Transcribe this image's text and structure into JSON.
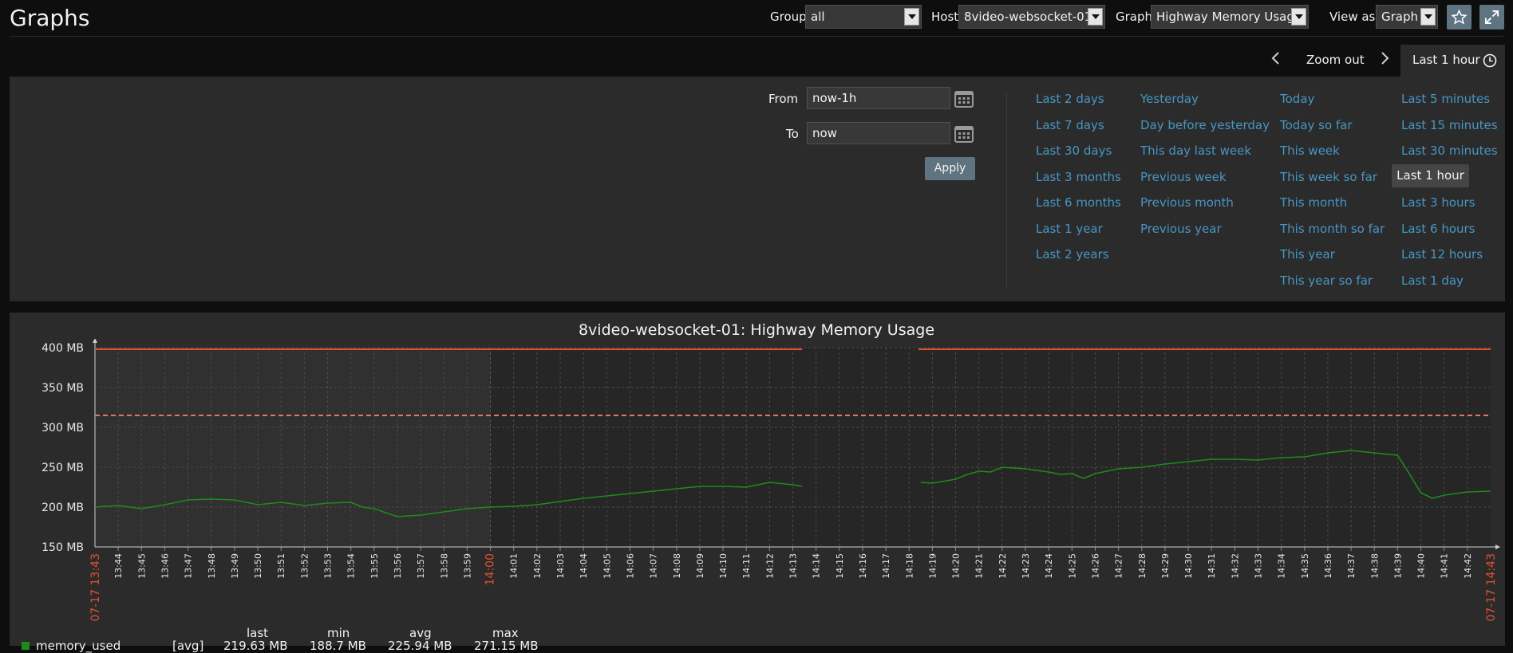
{
  "page": {
    "title": "Graphs"
  },
  "filters": {
    "group_label": "Group",
    "group_value": "all",
    "host_label": "Host",
    "host_value": "8video-websocket-01",
    "graph_label": "Graph",
    "graph_value": "Highway Memory Usage",
    "viewas_label": "View as",
    "viewas_value": "Graph"
  },
  "timenav": {
    "zoom_out": "Zoom out",
    "active_tab": "Last 1 hour"
  },
  "timeform": {
    "from_label": "From",
    "from_value": "now-1h",
    "to_label": "To",
    "to_value": "now",
    "apply": "Apply"
  },
  "quick_ranges": [
    [
      "Last 2 days",
      "Last 7 days",
      "Last 30 days",
      "Last 3 months",
      "Last 6 months",
      "Last 1 year",
      "Last 2 years"
    ],
    [
      "Yesterday",
      "Day before yesterday",
      "This day last week",
      "Previous week",
      "Previous month",
      "Previous year"
    ],
    [
      "Today",
      "Today so far",
      "This week",
      "This week so far",
      "This month",
      "This month so far",
      "This year",
      "This year so far"
    ],
    [
      "Last 5 minutes",
      "Last 15 minutes",
      "Last 30 minutes",
      "Last 1 hour",
      "Last 3 hours",
      "Last 6 hours",
      "Last 12 hours",
      "Last 1 day"
    ]
  ],
  "quick_selected": "Last 1 hour",
  "graph": {
    "title": "8video-websocket-01: Highway Memory Usage"
  },
  "colors": {
    "accent": "#4796c4",
    "button": "#5e7480",
    "series": "#1e8a1e",
    "trigger": "#e0522f",
    "threshold": "#e07a5f",
    "edge_label": "#e0522f"
  },
  "icons": [
    "star-icon",
    "fullscreen-icon",
    "chevron-left-icon",
    "chevron-right-icon",
    "clock-icon",
    "calendar-icon"
  ],
  "chart_data": {
    "type": "line",
    "title": "8video-websocket-01: Highway Memory Usage",
    "x_start_label": "07-17 13:43",
    "x_end_label": "07-17 14:43",
    "x_ticks": [
      "13:44",
      "13:45",
      "13:46",
      "13:47",
      "13:48",
      "13:49",
      "13:50",
      "13:51",
      "13:52",
      "13:53",
      "13:54",
      "13:55",
      "13:56",
      "13:57",
      "13:58",
      "13:59",
      "14:00",
      "14:01",
      "14:02",
      "14:03",
      "14:04",
      "14:05",
      "14:06",
      "14:07",
      "14:08",
      "14:09",
      "14:10",
      "14:11",
      "14:12",
      "14:13",
      "14:14",
      "14:15",
      "14:16",
      "14:17",
      "14:18",
      "14:19",
      "14:20",
      "14:21",
      "14:22",
      "14:23",
      "14:24",
      "14:25",
      "14:26",
      "14:27",
      "14:28",
      "14:29",
      "14:30",
      "14:31",
      "14:32",
      "14:33",
      "14:34",
      "14:35",
      "14:36",
      "14:37",
      "14:38",
      "14:39",
      "14:40",
      "14:41",
      "14:42"
    ],
    "highlight_tick": "14:00",
    "y_ticks": [
      "400 MB",
      "350 MB",
      "300 MB",
      "250 MB",
      "200 MB",
      "150 MB"
    ],
    "ylim": [
      150,
      400
    ],
    "xlim_minutes": [
      0,
      60
    ],
    "grid": true,
    "trigger_line_mb": 398,
    "threshold_line_mb": 315,
    "gap_minutes": [
      30.4,
      35.5
    ],
    "series": [
      {
        "values": [
          [
            0,
            200
          ],
          [
            1,
            202
          ],
          [
            2,
            198
          ],
          [
            3,
            203
          ],
          [
            4,
            209
          ],
          [
            5,
            210
          ],
          [
            6,
            209
          ],
          [
            7,
            203
          ],
          [
            8,
            206
          ],
          [
            9,
            202
          ],
          [
            10,
            205
          ],
          [
            11,
            206
          ],
          [
            11.5,
            200
          ],
          [
            12,
            198
          ],
          [
            13,
            188
          ],
          [
            14,
            190
          ],
          [
            15,
            194
          ],
          [
            16,
            198
          ],
          [
            17,
            200
          ],
          [
            18,
            201
          ],
          [
            19,
            203
          ],
          [
            20,
            207
          ],
          [
            21,
            211
          ],
          [
            22,
            214
          ],
          [
            23,
            217
          ],
          [
            24,
            220
          ],
          [
            25,
            223
          ],
          [
            26,
            226
          ],
          [
            27,
            226
          ],
          [
            28,
            225
          ],
          [
            29,
            231
          ],
          [
            30,
            228
          ],
          [
            30.4,
            226
          ],
          [
            35.5,
            231
          ],
          [
            36,
            230
          ],
          [
            37,
            235
          ],
          [
            37.5,
            241
          ],
          [
            38,
            245
          ],
          [
            38.5,
            244
          ],
          [
            39,
            250
          ],
          [
            40,
            248
          ],
          [
            41,
            244
          ],
          [
            41.5,
            241
          ],
          [
            42,
            242
          ],
          [
            42.5,
            236
          ],
          [
            43,
            242
          ],
          [
            44,
            248
          ],
          [
            45,
            250
          ],
          [
            46,
            254
          ],
          [
            47,
            257
          ],
          [
            48,
            260
          ],
          [
            49,
            260
          ],
          [
            50,
            259
          ],
          [
            51,
            262
          ],
          [
            52,
            263
          ],
          [
            53,
            268
          ],
          [
            54,
            271
          ],
          [
            55,
            268
          ],
          [
            56,
            265
          ],
          [
            56.5,
            242
          ],
          [
            57,
            218
          ],
          [
            57.5,
            211
          ],
          [
            58,
            215
          ],
          [
            59,
            219
          ],
          [
            60,
            220
          ]
        ]
      }
    ]
  },
  "legend": {
    "headers": [
      "last",
      "min",
      "avg",
      "max"
    ],
    "row": {
      "name": "memory_used",
      "func": "[avg]",
      "last": "219.63 MB",
      "min": "188.7 MB",
      "avg": "225.94 MB",
      "max": "271.15 MB"
    }
  }
}
